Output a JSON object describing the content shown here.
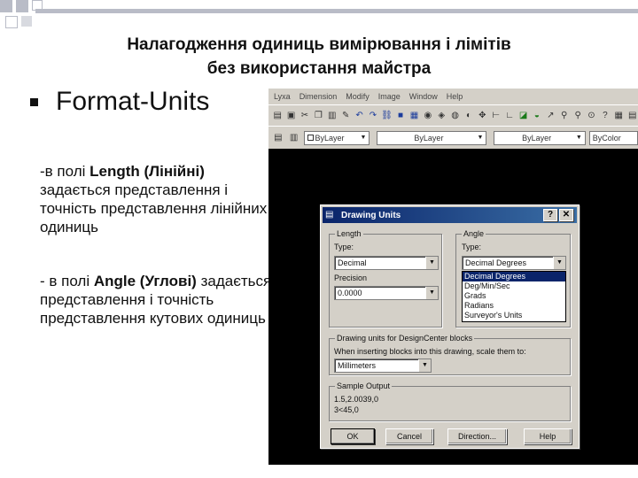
{
  "slide": {
    "title_line1": "Налагодження одиниць вимірювання і лімітів",
    "title_line2": "без використання майстра",
    "bullet": "Format-Units",
    "para1": {
      "prefix": "-в полі ",
      "bold": "Length (Лінійні)",
      "rest": " задається представлення і точність представлення лінійних одиниць"
    },
    "para2": {
      "prefix": "- в полі ",
      "bold": "Angle (Углові)",
      "rest": " задається представлення і точність представлення кутових одиниць"
    }
  },
  "acad": {
    "menu": [
      "Lyxa",
      "Dimension",
      "Modify",
      "Image",
      "Window",
      "Help"
    ],
    "layer_combo": "ByLayer",
    "linetype_combo": "ByLayer",
    "lineweight_combo": "ByLayer",
    "color_combo": "ByColor"
  },
  "dialog": {
    "title": "Drawing Units",
    "help_btn": "?",
    "close_btn": "✕",
    "length": {
      "group": "Length",
      "type_label": "Type:",
      "type_value": "Decimal",
      "precision_label": "Precision",
      "precision_value": "0.0000"
    },
    "angle": {
      "group": "Angle",
      "type_label": "Type:",
      "type_value": "Decimal Degrees",
      "options": [
        "Decimal Degrees",
        "Deg/Min/Sec",
        "Grads",
        "Radians",
        "Surveyor's Units"
      ],
      "selected_index": 0
    },
    "designcenter": {
      "group": "Drawing units for DesignCenter blocks",
      "label": "When inserting blocks into this drawing, scale them to:",
      "value": "Millimeters"
    },
    "sample": {
      "group": "Sample Output",
      "line1": "1.5,2.0039,0",
      "line2": "3<45,0"
    },
    "buttons": {
      "ok": "OK",
      "cancel": "Cancel",
      "direction": "Direction...",
      "help": "Help"
    }
  }
}
